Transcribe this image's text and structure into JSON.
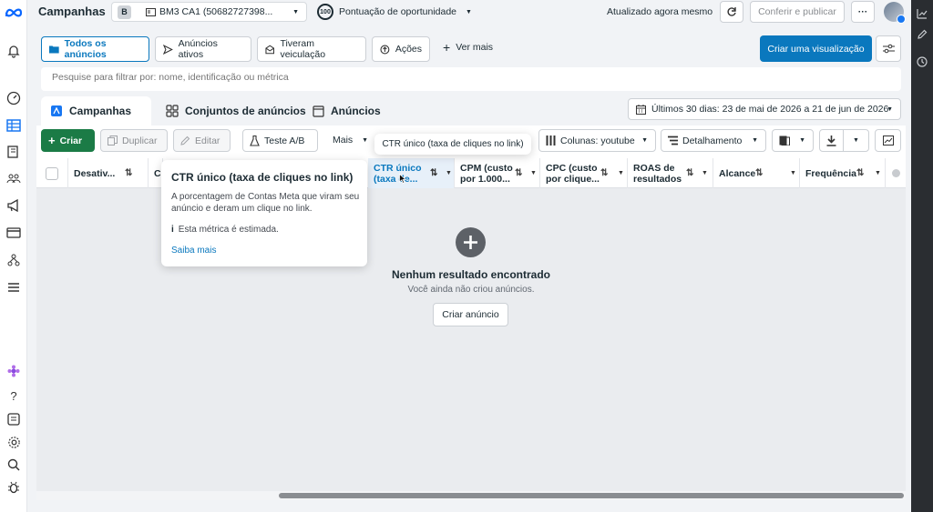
{
  "topbar": {
    "title": "Campanhas",
    "account_badge": "B",
    "account_name": "BM3 CA1 (50682727398...",
    "opportunity_score": "100",
    "opportunity_label": "Pontuação de oportunidade",
    "updated_text": "Atualizado agora mesmo",
    "review_publish": "Conferir e publicar",
    "more_label": "···"
  },
  "filters": {
    "items": [
      {
        "label": "Todos os anúncios"
      },
      {
        "label": "Anúncios ativos"
      },
      {
        "label": "Tiveram veiculação"
      },
      {
        "label": "Ações"
      }
    ],
    "see_more": "Ver mais",
    "create_view": "Criar uma visualização"
  },
  "search": {
    "placeholder": "Pesquise para filtrar por: nome, identificação ou métrica"
  },
  "tabs": {
    "campaigns": "Campanhas",
    "adsets": "Conjuntos de anúncios",
    "ads": "Anúncios"
  },
  "date_range": "Últimos 30 dias: 23 de mai de 2026 a 21 de jun de 2026",
  "toolbar": {
    "create": "Criar",
    "duplicate": "Duplicar",
    "edit": "Editar",
    "ab_test": "Teste A/B",
    "more": "Mais",
    "columns": "Colunas: youtube",
    "breakdown": "Detalhamento"
  },
  "table": {
    "columns": [
      {
        "l1": "Desativ...",
        "l2": ""
      },
      {
        "l1": "C",
        "l2": ""
      },
      {
        "l1": "CTR único",
        "l2": "(taxa de..."
      },
      {
        "l1": "CPM (custo",
        "l2": "por 1.000..."
      },
      {
        "l1": "CPC (custo",
        "l2": "por clique..."
      },
      {
        "l1": "ROAS de",
        "l2": "resultados"
      },
      {
        "l1": "Alcance",
        "l2": ""
      },
      {
        "l1": "Frequência",
        "l2": ""
      }
    ]
  },
  "empty_state": {
    "title": "Nenhum resultado encontrado",
    "subtitle": "Você ainda não criou anúncios.",
    "button": "Criar anúncio"
  },
  "tooltip_small": "CTR único (taxa de cliques no link)",
  "tooltip_card": {
    "title": "CTR único (taxa de cliques no link)",
    "description": "A porcentagem de Contas Meta que viram seu anúncio e deram um clique no link.",
    "note": "Esta métrica é estimada.",
    "link": "Saiba mais"
  },
  "colors": {
    "primary": "#0a78be",
    "create_green": "#1b7b46",
    "active_tab_blue": "#1877f2"
  }
}
